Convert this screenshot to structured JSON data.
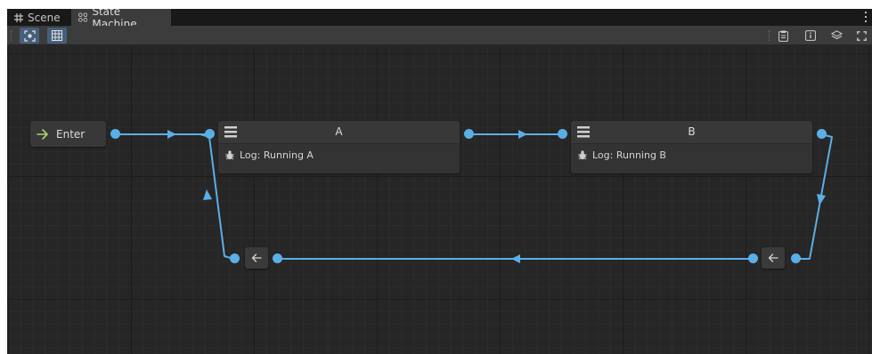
{
  "tabs": [
    {
      "label": "Scene",
      "icon": "grid-icon"
    },
    {
      "label": "State Machine",
      "icon": "state-machine-icon"
    }
  ],
  "toolbar": {
    "left": [
      {
        "name": "frame-all-button",
        "icon": "frame-icon",
        "active": true
      },
      {
        "name": "grid-toggle-button",
        "icon": "grid-icon",
        "active": true
      }
    ],
    "right": [
      {
        "name": "blackboard-button",
        "icon": "clipboard-icon"
      },
      {
        "name": "inspector-button",
        "icon": "info-icon"
      },
      {
        "name": "layers-button",
        "icon": "layers-icon"
      },
      {
        "name": "maximize-button",
        "icon": "maximize-icon"
      }
    ]
  },
  "graph": {
    "enter_node": {
      "label": "Enter",
      "icon": "arrow-right-icon"
    },
    "states": [
      {
        "id": "A",
        "title": "A",
        "action": "Log: Running A",
        "action_icon": "bug-icon"
      },
      {
        "id": "B",
        "title": "B",
        "action": "Log: Running B",
        "action_icon": "bug-icon"
      }
    ],
    "redirect_nodes": [
      {
        "id": "redirect-right",
        "icon": "arrow-left-icon"
      },
      {
        "id": "redirect-left",
        "icon": "arrow-left-icon"
      }
    ]
  },
  "colors": {
    "edge": "#5aafe6",
    "enter_arrow": "#a8d26c",
    "toolbar_active": "#46607c",
    "node_bg": "#383838",
    "canvas_bg": "#262626"
  }
}
